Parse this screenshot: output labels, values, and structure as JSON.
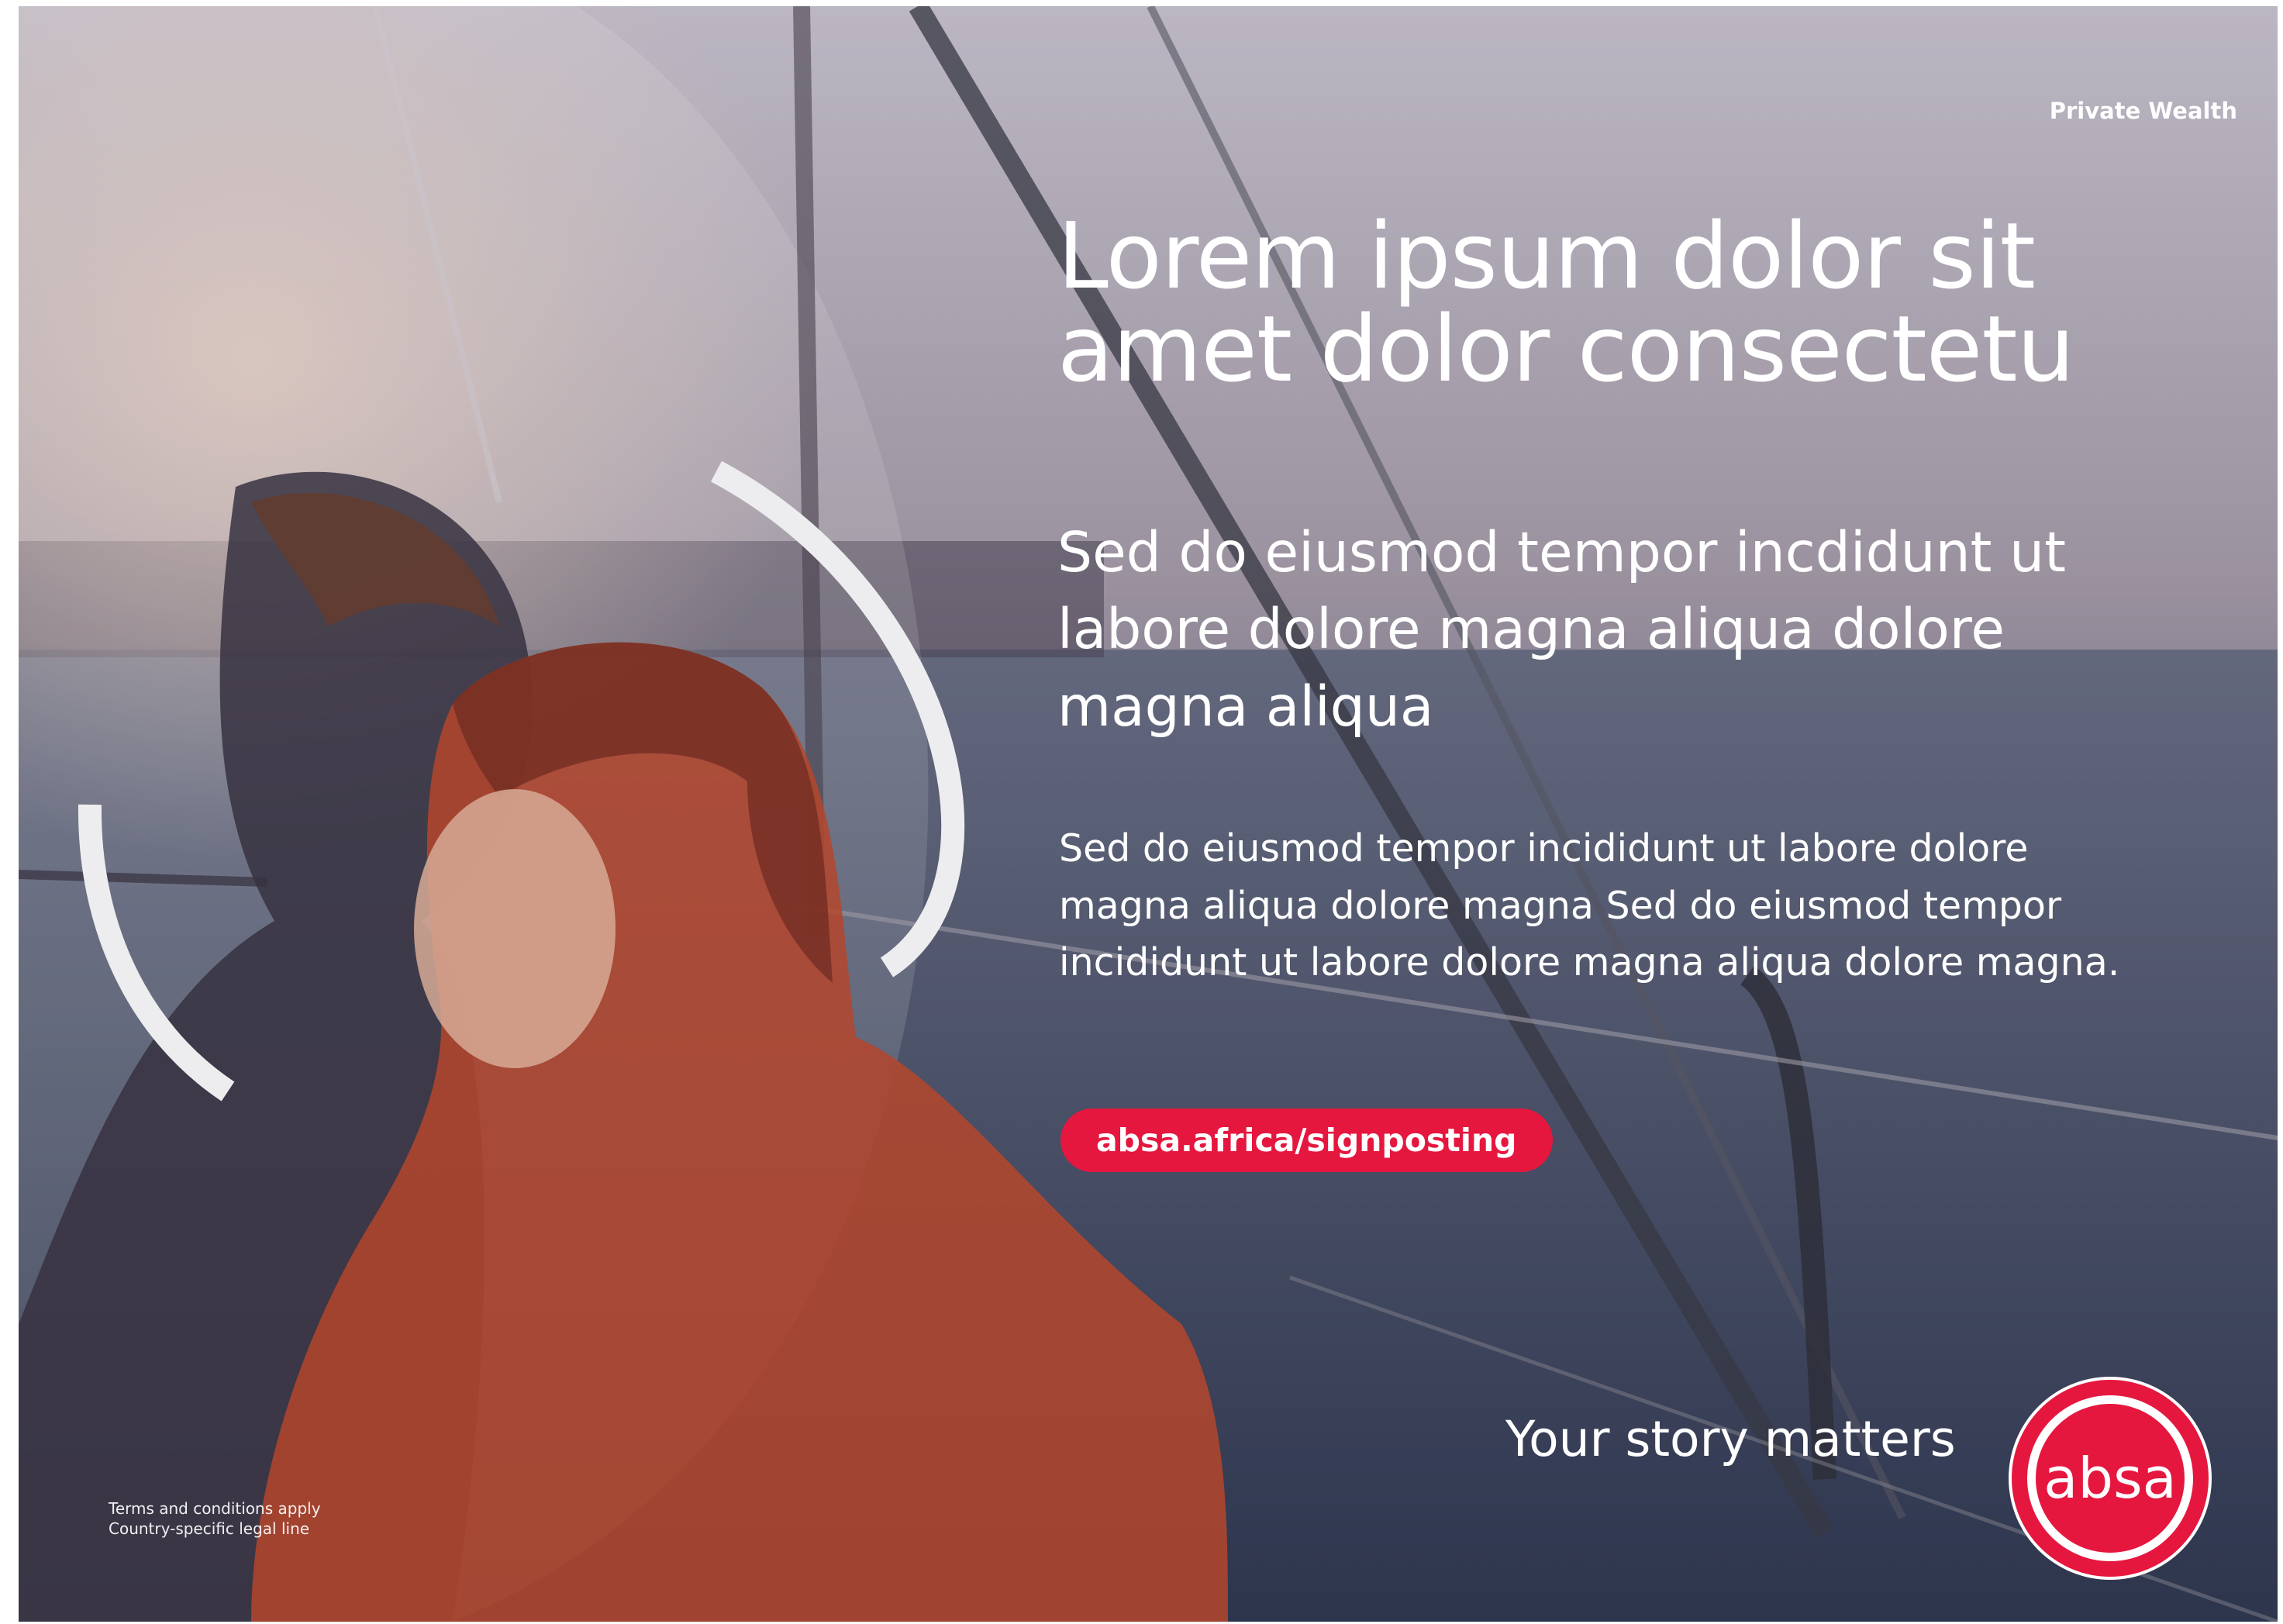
{
  "brand_label": "Private Wealth",
  "headline": "Lorem ipsum dolor sit\namet dolor consectetu",
  "subheadline": "Sed do eiusmod tempor incdidunt ut\nlabore dolore magna aliqua dolore\nmagna aliqua",
  "body": "Sed do eiusmod tempor incididunt ut labore dolore\nmagna aliqua dolore magna Sed do eiusmod tempor\nincididunt ut labore dolore magna aliqua dolore magna.",
  "cta": {
    "label": "absa.africa/signposting"
  },
  "tagline": "Your story matters",
  "logo": {
    "text": "absa"
  },
  "legal": "Terms and conditions apply\nCountry-specific legal line",
  "colors": {
    "brand_red": "#e5173f",
    "text": "#ffffff"
  }
}
